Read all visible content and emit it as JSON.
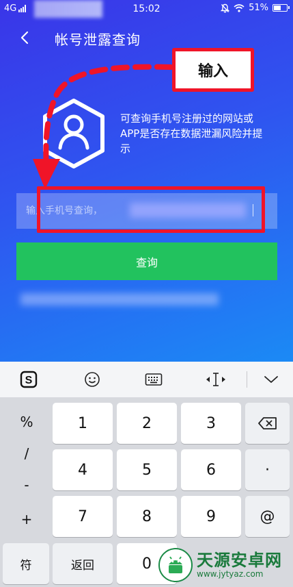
{
  "status_bar": {
    "network": "4G",
    "time": "15:02",
    "battery": "51%",
    "battery_level": 0.51
  },
  "header": {
    "back_icon": "chevron-left-icon",
    "title": "帐号泄露查询"
  },
  "intro": {
    "icon": "shield-user-icon",
    "description": "可查询手机号注册过的网站或APP是否存在数据泄漏风险并提示"
  },
  "search": {
    "placeholder": "输入手机号查询，",
    "button_label": "查询"
  },
  "annotation": {
    "label": "输入",
    "color": "#f01428"
  },
  "keyboard_toolbar": {
    "items": [
      "sogou-logo-icon",
      "emoji-icon",
      "keyboard-icon",
      "cursor-move-icon",
      "collapse-keyboard-icon"
    ]
  },
  "keyboard": {
    "side_keys": [
      "%",
      "/",
      "-",
      "+"
    ],
    "digits": [
      "1",
      "2",
      "3",
      "4",
      "5",
      "6",
      "7",
      "8",
      "9",
      "0"
    ],
    "right_keys": {
      "backspace": "backspace-icon",
      "dot": "·",
      "at": "@"
    },
    "symbol_key": "符",
    "back_key": "返回"
  },
  "watermark": {
    "name": "天源安卓网",
    "url": "www.jytyaz.com"
  },
  "colors": {
    "accent_green": "#22c25e",
    "highlight_red": "#f01428",
    "gradient_top": "#3a35e8",
    "gradient_bottom": "#1b8af5"
  }
}
